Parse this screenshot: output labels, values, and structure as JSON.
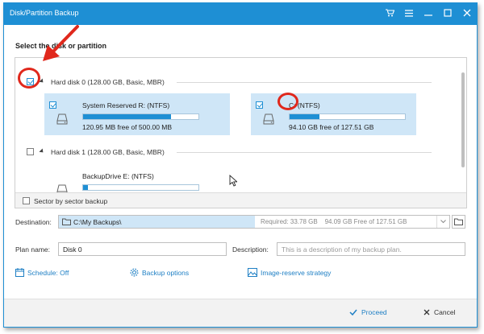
{
  "window": {
    "title": "Disk/Partition Backup"
  },
  "titlebar_icons": [
    "cart-icon",
    "menu-icon",
    "minimize-icon",
    "maximize-icon",
    "close-icon"
  ],
  "section": {
    "title": "Select the disk or partition"
  },
  "disks": [
    {
      "label": "Hard disk 0 (128.00 GB, Basic, MBR)",
      "checked": true,
      "partitions": [
        {
          "name": "System Reserved R: (NTFS)",
          "free": "120.95 MB free of 500.00 MB",
          "used_fraction": 0.76,
          "checked": true
        },
        {
          "name": "C: (NTFS)",
          "free": "94.10 GB free of 127.51 GB",
          "used_fraction": 0.26,
          "checked": true
        }
      ]
    },
    {
      "label": "Hard disk 1 (128.00 GB, Basic, MBR)",
      "checked": false,
      "partitions": [
        {
          "name": "BackupDrive E: (NTFS)",
          "free": "",
          "used_fraction": 0.04,
          "checked": false
        }
      ]
    }
  ],
  "sector_backup": {
    "label": "Sector by sector backup",
    "checked": false
  },
  "destination": {
    "label": "Destination:",
    "path": "C:\\My Backups\\",
    "required": "Required: 33.78 GB",
    "free": "94.09 GB Free of 127.51 GB"
  },
  "plan": {
    "label": "Plan name:",
    "value": "Disk 0"
  },
  "description": {
    "label": "Description:",
    "placeholder": "This is a description of my backup plan."
  },
  "options": {
    "schedule": "Schedule: Off",
    "backup_options": "Backup options",
    "image_reserve": "Image-reserve strategy"
  },
  "footer": {
    "proceed": "Proceed",
    "cancel": "Cancel"
  },
  "colors": {
    "accent": "#1e8fd4",
    "selection": "#cfe6f7",
    "annotation": "#e0281c"
  }
}
